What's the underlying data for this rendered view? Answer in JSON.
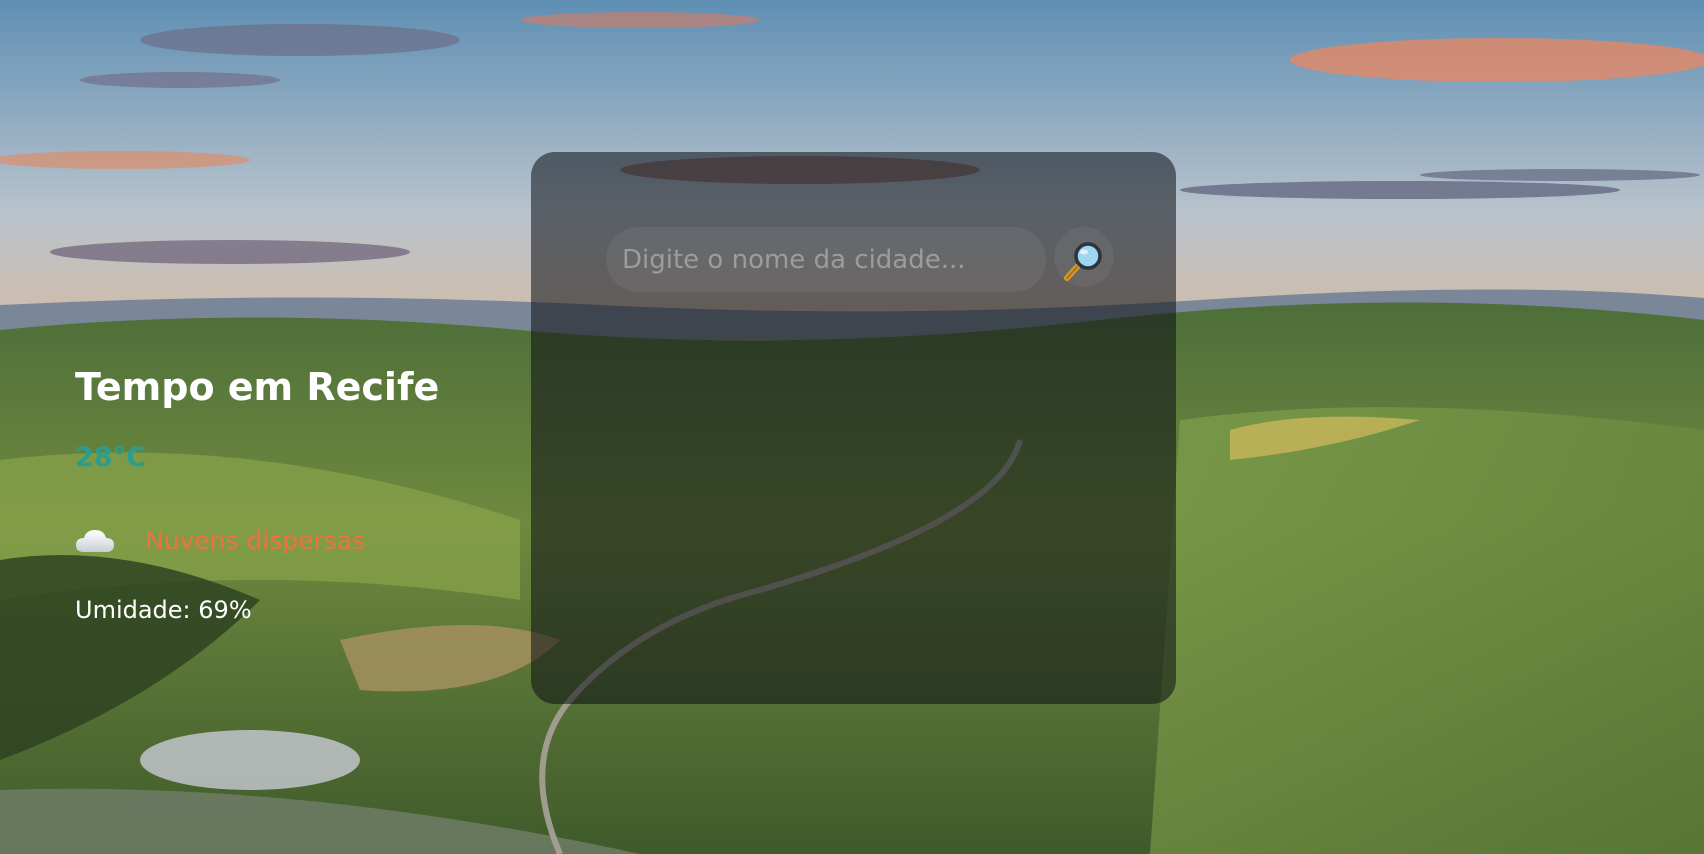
{
  "search": {
    "placeholder": "Digite o nome da cidade...",
    "value": ""
  },
  "weather": {
    "title": "Tempo em Recife",
    "temperature": "28°C",
    "condition": "Nuvens dispersas",
    "humidity_label": "Umidade:",
    "humidity_value": "69%"
  },
  "icons": {
    "search": "magnifying-glass-icon",
    "condition": "cloud-icon"
  },
  "colors": {
    "temperature": "#2a9d8f",
    "condition": "#f07140",
    "text": "#ffffff",
    "card": "rgba(12,14,20,0.55)"
  }
}
